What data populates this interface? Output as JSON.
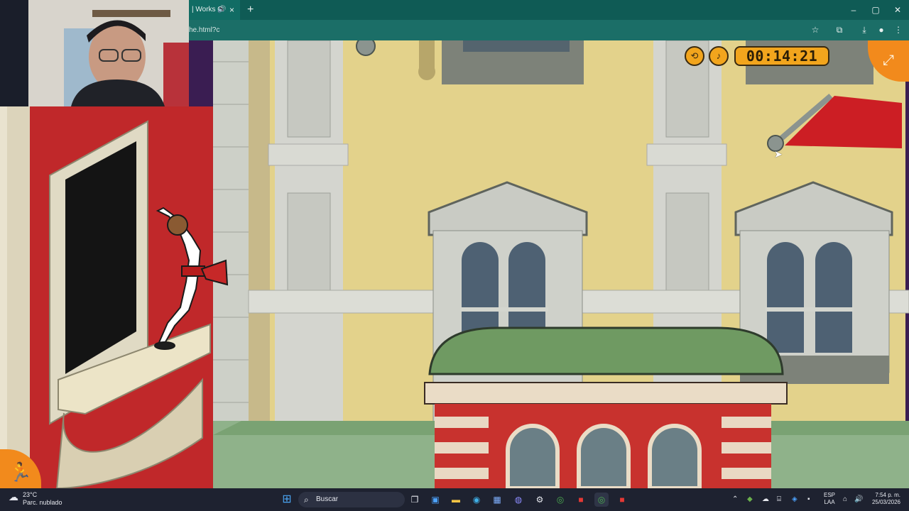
{
  "browser": {
    "tab_title": "| Works O",
    "tab_audio_icon": "speaker-icon",
    "tab_close_icon": "×",
    "new_tab_icon": "+",
    "url_fragment": "he.html?c",
    "window_controls": [
      "–",
      "▢",
      "✕"
    ]
  },
  "game": {
    "timer": "00:14:21",
    "hud_buttons": [
      "restart-icon",
      "music-icon"
    ],
    "fullscreen_icon": "expand-icon",
    "run_icon": "runner-icon"
  },
  "taskbar": {
    "weather_temp": "23°C",
    "weather_desc": "Parc. nublado",
    "search_placeholder": "Buscar",
    "lang_top": "ESP",
    "lang_bottom": "LAA",
    "time": "7:54 p. m.",
    "date": "25/03/2026"
  },
  "colors": {
    "chrome_tab": "#0f5b55",
    "chrome_addr": "#1b6e67",
    "hud_orange": "#f2a51d",
    "wall_yellow": "#e3d28b",
    "red_wall": "#c0282a",
    "awning_red": "#cc1e24",
    "roof_green": "#6f9a62",
    "taskbar": "#1e2230"
  }
}
